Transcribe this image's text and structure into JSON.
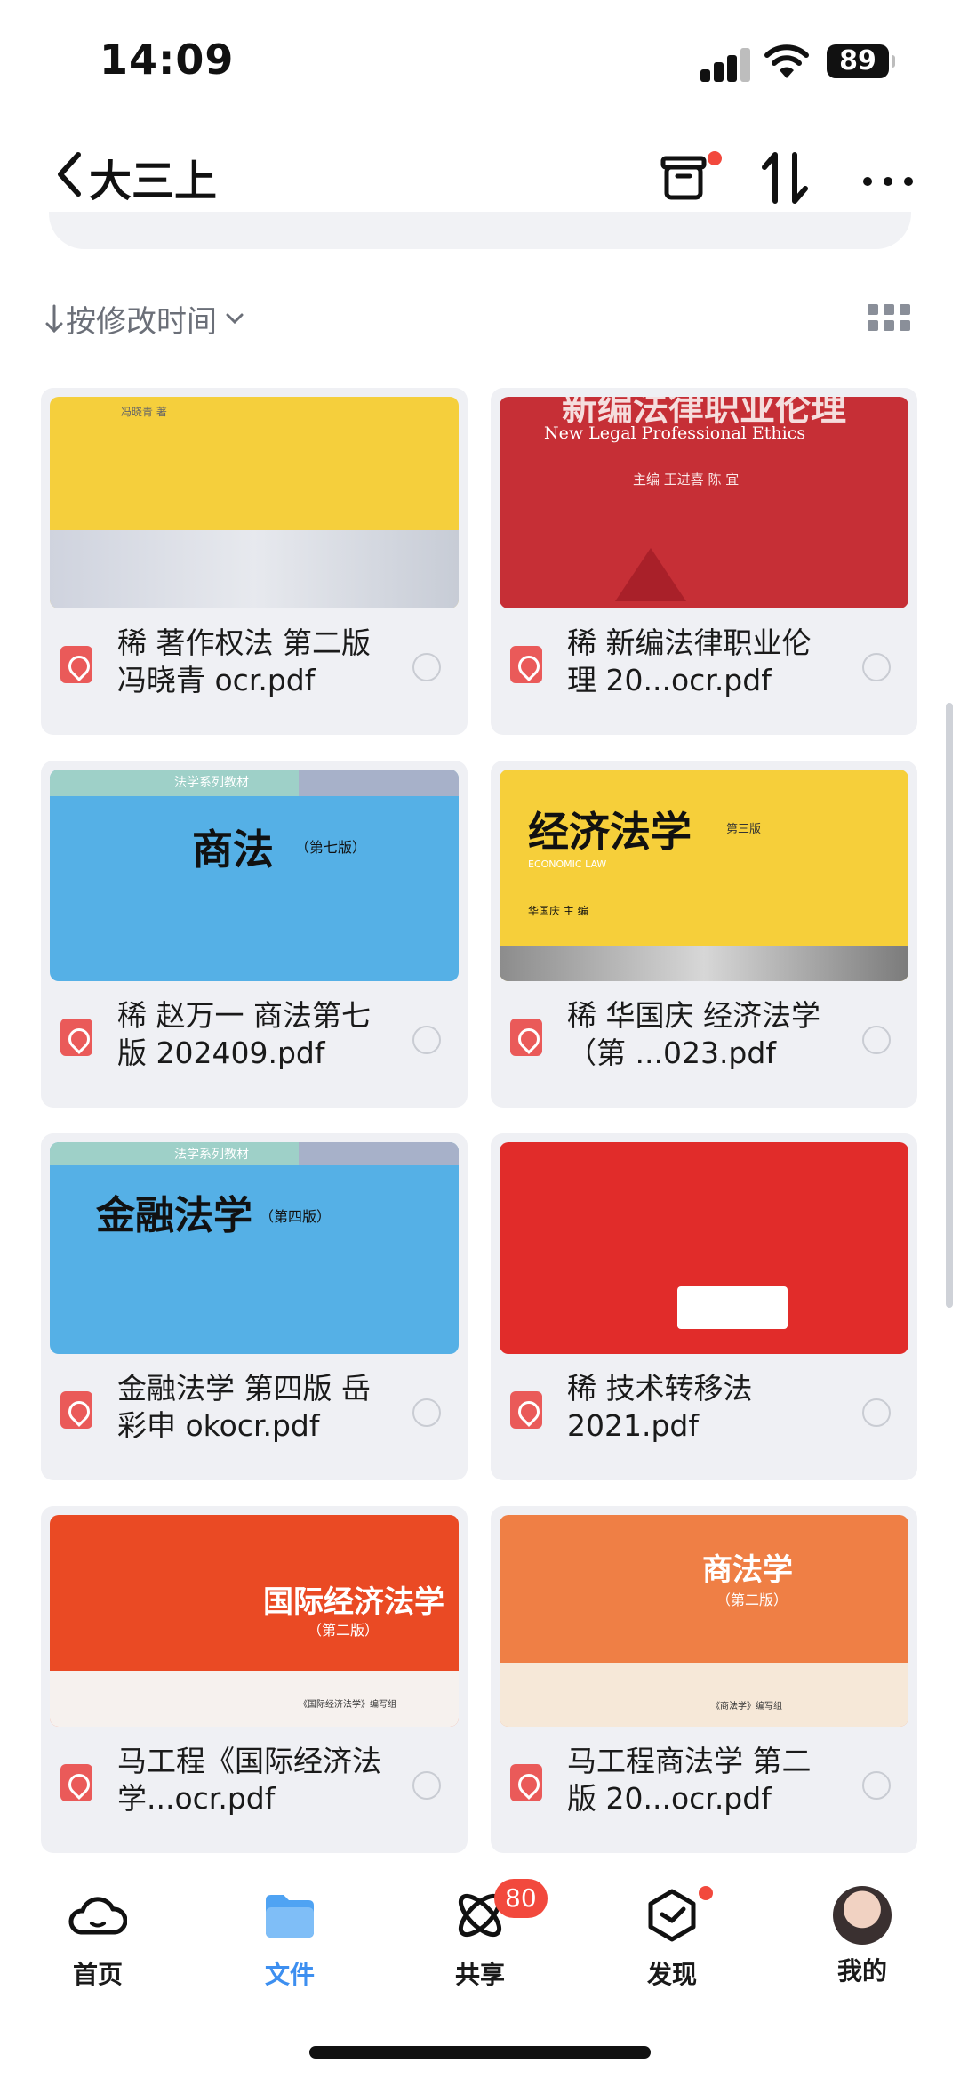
{
  "status": {
    "time": "14:09",
    "battery": "89"
  },
  "nav": {
    "title": "大三上"
  },
  "sort": {
    "label": "按修改时间"
  },
  "files": [
    {
      "name": "稀 著作权法 第二版 冯晓青 ocr.pdf",
      "cover_text": "冯晓青 著"
    },
    {
      "name": "稀 新编法律职业伦理 20...ocr.pdf",
      "cover_title": "新编法律职业伦理",
      "cover_sub": "New Legal Professional Ethics",
      "cover_small": "主编  王进喜  陈 宜"
    },
    {
      "name": "稀 赵万一 商法第七版 202409.pdf",
      "cover_banner": "法学系列教材",
      "cover_title": "商法",
      "cover_ed": "（第七版）"
    },
    {
      "name": "稀 华国庆 经济法学（第 ...023.pdf",
      "cover_title": "经济法学",
      "cover_ed": "第三版",
      "cover_sub": "ECONOMIC LAW",
      "cover_small": "华国庆  主 编"
    },
    {
      "name": "金融法学 第四版 岳彩申 okocr.pdf",
      "cover_banner": "法学系列教材",
      "cover_title": "金融法学",
      "cover_ed": "（第四版）"
    },
    {
      "name": "稀 技术转移法 2021.pdf"
    },
    {
      "name": "马工程《国际经济法学...ocr.pdf",
      "cover_title": "国际经济法学",
      "cover_ed": "（第二版）",
      "cover_small": "《国际经济法学》编写组"
    },
    {
      "name": "马工程商法学 第二版 20...ocr.pdf",
      "cover_title": "商法学",
      "cover_ed": "（第二版）",
      "cover_small": "《商法学》编写组"
    }
  ],
  "tabs": [
    {
      "label": "首页",
      "icon": "cloud-icon"
    },
    {
      "label": "文件",
      "icon": "folder-icon"
    },
    {
      "label": "共享",
      "icon": "share-icon",
      "badge": "80"
    },
    {
      "label": "发现",
      "icon": "discover-icon"
    },
    {
      "label": "我的",
      "icon": "avatar"
    }
  ]
}
